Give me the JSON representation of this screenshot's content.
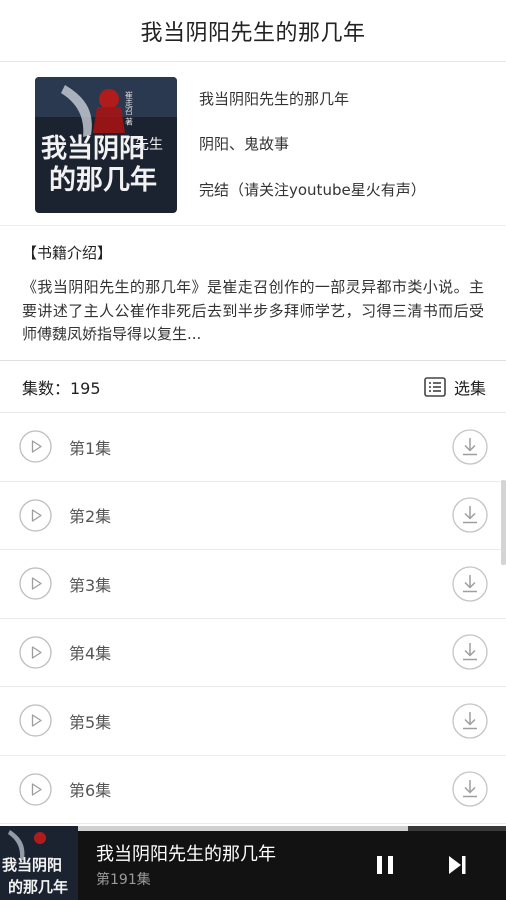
{
  "header": {
    "title": "我当阴阳先生的那几年"
  },
  "book": {
    "title": "我当阴阳先生的那几年",
    "category": "阴阳、鬼故事",
    "status": "完结（请关注youtube星火有声）",
    "cover_icon": "book-cover-image",
    "cover_title": "我当阴阳先生的那几年",
    "cover_author": "崔走召 著"
  },
  "intro": {
    "header": "【书籍介绍】",
    "text": "《我当阴阳先生的那几年》是崔走召创作的一部灵异都市类小说。主要讲述了主人公崔作非死后去到半步多拜师学艺，习得三清书而后受师傅魏凤娇指导得以复生..."
  },
  "episodes": {
    "count_label": "集数：195",
    "select_label": "选集",
    "items": [
      {
        "label": "第1集"
      },
      {
        "label": "第2集"
      },
      {
        "label": "第3集"
      },
      {
        "label": "第4集"
      },
      {
        "label": "第5集"
      },
      {
        "label": "第6集"
      }
    ]
  },
  "player": {
    "title": "我当阴阳先生的那几年",
    "episode": "第191集",
    "progress": 0.77
  },
  "colors": {
    "player_bg": "#121212",
    "cover_bg": "#1b2230"
  }
}
